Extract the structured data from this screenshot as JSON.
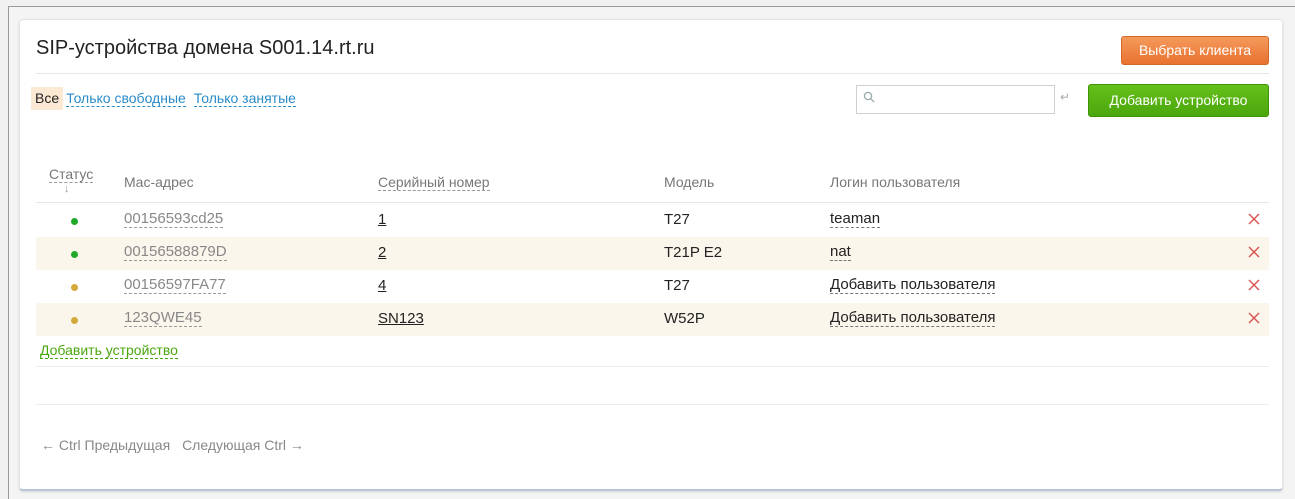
{
  "header": {
    "title": "SIP-устройства домена S001.14.rt.ru",
    "select_client_label": "Выбрать клиента"
  },
  "filters": {
    "all": "Все",
    "free_only": "Только свободные",
    "busy_only": "Только занятые"
  },
  "search": {
    "placeholder": "",
    "value": ""
  },
  "add_device_button": "Добавить устройство",
  "table": {
    "columns": [
      "Статус",
      "Mac-адрес",
      "Серийный номер",
      "Модель",
      "Логин пользователя"
    ],
    "rows": [
      {
        "status": "online",
        "status_color": "#1faa2a",
        "mac": "00156593cd25",
        "serial": "1",
        "model": "T27",
        "login": "teaman"
      },
      {
        "status": "online",
        "status_color": "#1faa2a",
        "mac": "00156588879D",
        "serial": "2",
        "model": "T21P E2",
        "login": "nat"
      },
      {
        "status": "idle",
        "status_color": "#d4a93a",
        "mac": "00156597FA77",
        "serial": "4",
        "model": "T27",
        "login": "Добавить пользователя"
      },
      {
        "status": "idle",
        "status_color": "#d4a93a",
        "mac": "123QWE45",
        "serial": "SN123",
        "model": "W52P",
        "login": "Добавить пользователя"
      }
    ]
  },
  "add_device_link": "Добавить устройство",
  "pager": {
    "prev": "← Ctrl Предыдущая",
    "next": "Следующая Ctrl →"
  },
  "colors": {
    "accent_orange": "#e8722f",
    "accent_green": "#4aa70c",
    "link_blue": "#2a8cc7",
    "delete_red": "#d9534f"
  },
  "icons": {
    "search": "search-icon",
    "enter": "enter-icon",
    "delete": "close-icon",
    "sort": "sort-arrow-icon"
  }
}
